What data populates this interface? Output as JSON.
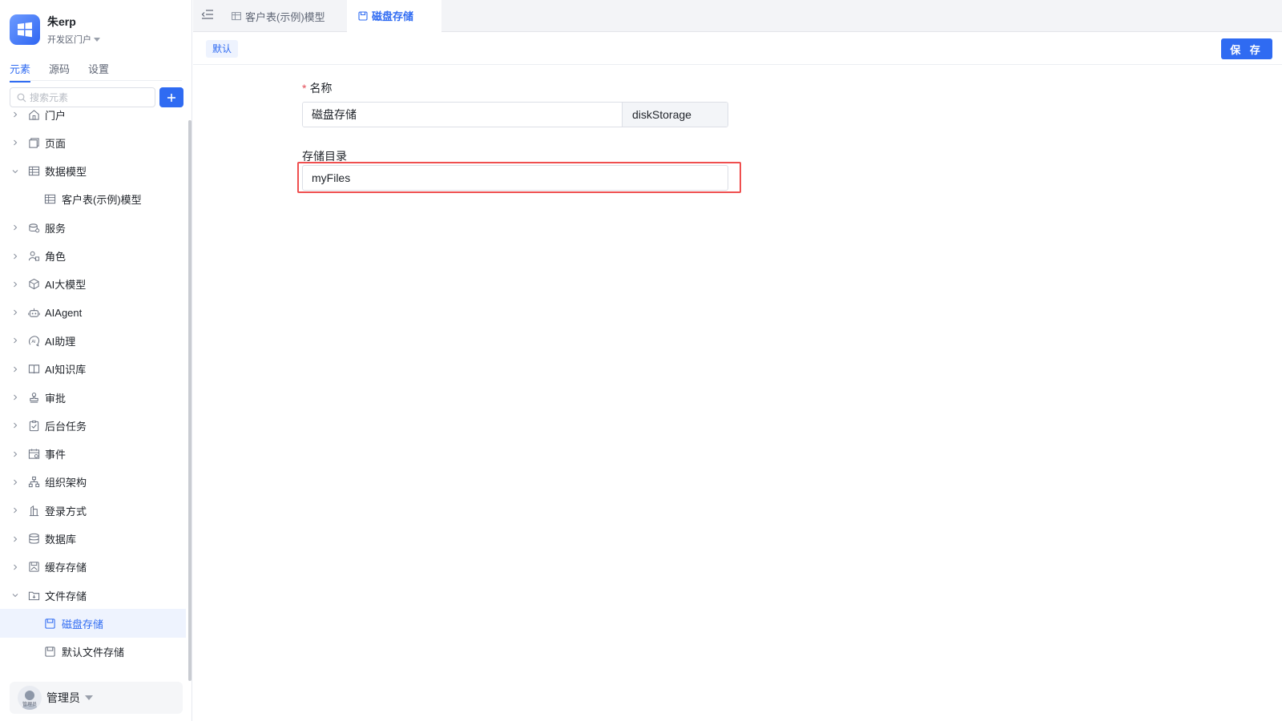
{
  "app": {
    "name": "朱erp",
    "portal": "开发区门户"
  },
  "sidebar": {
    "tabs": [
      "元素",
      "源码",
      "设置"
    ],
    "search_placeholder": "搜索元素",
    "tree": [
      {
        "label": "门户",
        "icon": "home-icon"
      },
      {
        "label": "页面",
        "icon": "pages-icon"
      },
      {
        "label": "数据模型",
        "icon": "table-icon",
        "expanded": true
      },
      {
        "label": "客户表(示例)模型",
        "icon": "table-icon",
        "child": true
      },
      {
        "label": "服务",
        "icon": "service-icon"
      },
      {
        "label": "角色",
        "icon": "role-icon"
      },
      {
        "label": "AI大模型",
        "icon": "cube-icon"
      },
      {
        "label": "AIAgent",
        "icon": "robot-icon"
      },
      {
        "label": "AI助理",
        "icon": "ai-assistant-icon"
      },
      {
        "label": "AI知识库",
        "icon": "book-icon"
      },
      {
        "label": "审批",
        "icon": "stamp-icon"
      },
      {
        "label": "后台任务",
        "icon": "task-icon"
      },
      {
        "label": "事件",
        "icon": "calendar-icon"
      },
      {
        "label": "组织架构",
        "icon": "org-icon"
      },
      {
        "label": "登录方式",
        "icon": "login-icon"
      },
      {
        "label": "数据库",
        "icon": "database-icon"
      },
      {
        "label": "缓存存储",
        "icon": "cache-icon"
      },
      {
        "label": "文件存储",
        "icon": "folder-icon",
        "expanded": true
      },
      {
        "label": "磁盘存储",
        "icon": "disk-icon",
        "child": true,
        "selected": true
      },
      {
        "label": "默认文件存储",
        "icon": "disk-icon",
        "child": true
      }
    ],
    "user": {
      "name": "管理员",
      "avatar_text": "管理员"
    }
  },
  "tabs": [
    {
      "label": "客户表(示例)模型",
      "icon": "table-icon",
      "active": false
    },
    {
      "label": "磁盘存储",
      "icon": "disk-icon",
      "active": true
    }
  ],
  "toolbar": {
    "chip": "默认",
    "save_label": "保 存"
  },
  "form": {
    "name_label": "名称",
    "name_required": "*",
    "name_value": "磁盘存储",
    "name_code": "diskStorage",
    "dir_label": "存储目录",
    "dir_value": "myFiles"
  },
  "colors": {
    "accent": "#2f6bf2",
    "highlight": "#ef4f4f"
  }
}
